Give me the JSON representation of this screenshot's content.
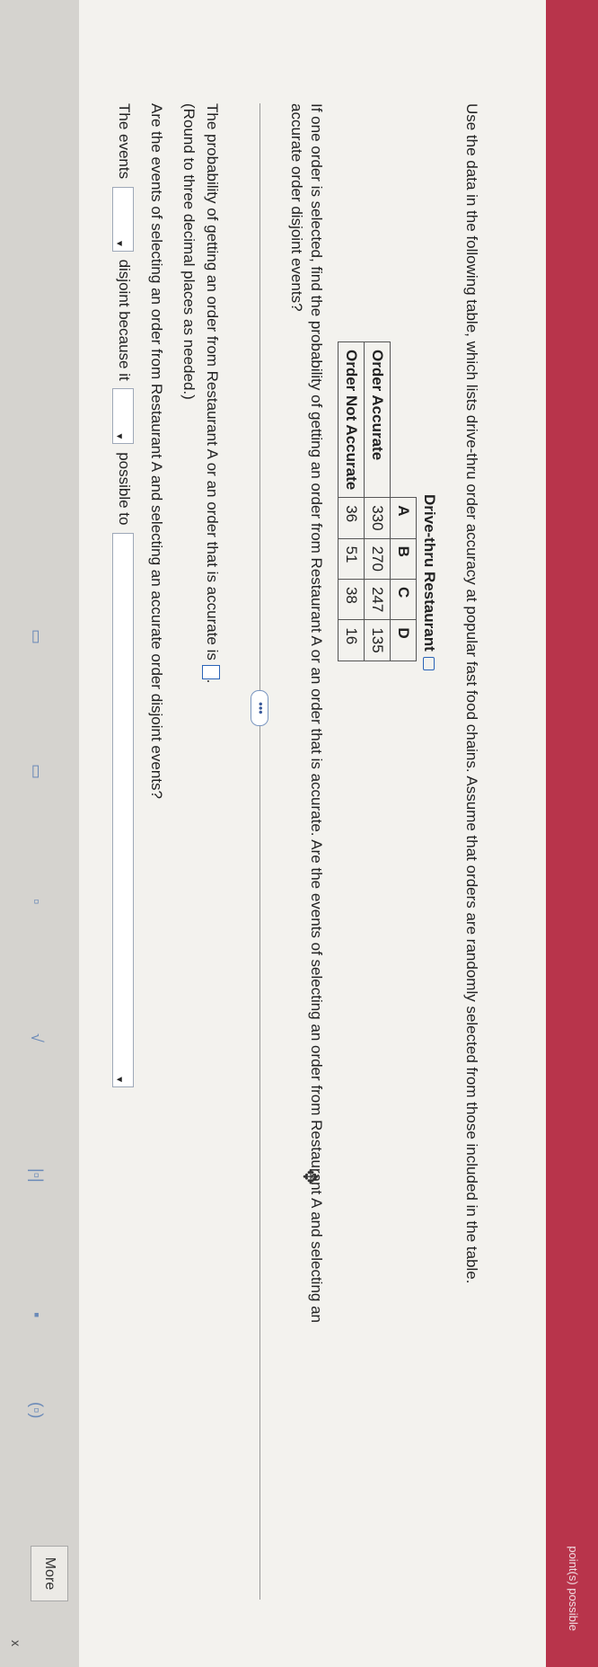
{
  "header": {
    "points_text": "point(s) possible"
  },
  "question": {
    "intro": "Use the data in the following table, which lists drive-thru order accuracy at popular fast food chains. Assume that orders are randomly selected from those included in the table.",
    "table_title": "Drive-thru Restaurant",
    "columns": [
      "A",
      "B",
      "C",
      "D"
    ],
    "rows": [
      {
        "label": "Order Accurate",
        "values": [
          "330",
          "270",
          "247",
          "135"
        ]
      },
      {
        "label": "Order Not Accurate",
        "values": [
          "36",
          "51",
          "38",
          "16"
        ]
      }
    ],
    "prompt": "If one order is selected, find the probability of getting an order from Restaurant A or an order that is accurate. Are the events of selecting an order from Restaurant A and selecting an accurate order disjoint events?"
  },
  "controls": {
    "expand_label": "•••",
    "move_icon": "move-icon"
  },
  "answer": {
    "line1": "The probability of getting an order from Restaurant A or an order that is accurate is",
    "line1_end": ".",
    "line2": "(Round to three decimal places as needed.)",
    "line3": "Are the events of selecting an order from Restaurant A and selecting an accurate order disjoint events?",
    "line4_prefix": "The events",
    "line4_mid1": "disjoint because it",
    "line4_mid2": "possible to"
  },
  "footer": {
    "more_label": "More",
    "close_label": "x"
  }
}
